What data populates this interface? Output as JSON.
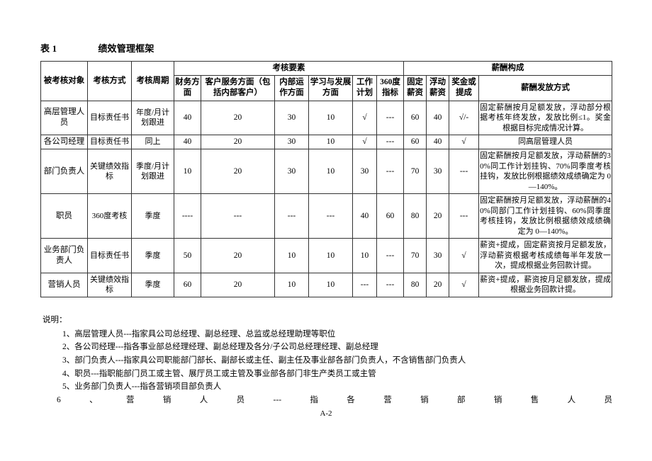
{
  "document": {
    "table_label": "表 1",
    "table_title": "绩效管理框架",
    "footer": "A-2"
  },
  "table": {
    "group_headers": {
      "assessment_elements": "考核要素",
      "salary_composition": "薪酬构成"
    },
    "columns": {
      "object": "被考核对象",
      "method": "考核方式",
      "cycle": "考核周期",
      "finance": "财务方面",
      "customer": "客户服务方面（包括内部客户）",
      "internal": "内部运作方面",
      "learning": "学习与发展方面",
      "work_plan": "工作计划",
      "deg360": "360度指标",
      "fixed_salary": "固定薪资",
      "float_salary": "浮动薪资",
      "bonus": "奖金或提成",
      "pay_method": "薪酬发放方式"
    },
    "rows": [
      {
        "object": "高层管理人员",
        "method": "目标责任书",
        "cycle": "年度/月计划跟进",
        "finance": "40",
        "customer": "20",
        "internal": "30",
        "learning": "10",
        "work_plan": "√",
        "deg360": "---",
        "fixed_salary": "60",
        "float_salary": "40",
        "bonus": "√/-",
        "pay_method": "固定薪酬按月足额发放，浮动部分根据考核年终发放，发放比例≤1。奖金根据目标完成情况计算。",
        "pay_method_justify": true
      },
      {
        "object": "各公司经理",
        "method": "目标责任书",
        "cycle": "同上",
        "finance": "40",
        "customer": "20",
        "internal": "30",
        "learning": "10",
        "work_plan": "√",
        "deg360": "---",
        "fixed_salary": "60",
        "float_salary": "40",
        "bonus": "√",
        "pay_method": "同高层管理人员",
        "pay_method_justify": false
      },
      {
        "object": "部门负责人",
        "method": "关键绩效指标",
        "cycle": "季度/月计划跟进",
        "finance": "10",
        "customer": "20",
        "internal": "30",
        "learning": "10",
        "work_plan": "30",
        "deg360": "---",
        "fixed_salary": "70",
        "float_salary": "30",
        "bonus": "---",
        "pay_method": "固定薪酬按月足额发放，浮动薪酬的30%同工作计划挂钩、70%同季度考核挂钩，发放比例根据绩效成绩确定为 0—140%。",
        "pay_method_justify": true
      },
      {
        "object": "职员",
        "method": "360度考核",
        "cycle": "季度",
        "finance": "----",
        "customer": "---",
        "internal": "---",
        "learning": "---",
        "work_plan": "40",
        "deg360": "60",
        "fixed_salary": "80",
        "float_salary": "20",
        "bonus": "---",
        "pay_method": "固定薪酬按月足额发放，浮动薪酬的40%同部门工作计划挂钩、60%同季度考核挂钩，发放比例根据绩效成绩确定为 0—140%。",
        "pay_method_justify": true
      },
      {
        "object": "业务部门负责人",
        "method": "目标责任书",
        "cycle": "季度",
        "finance": "50",
        "customer": "20",
        "internal": "10",
        "learning": "10",
        "work_plan": "10",
        "deg360": "---",
        "fixed_salary": "70",
        "float_salary": "30",
        "bonus": "√",
        "pay_method": "薪资+提成，固定薪资按月足额发放，浮动薪资根据考核成绩每半年发放一次，提成根据业务回款计提。",
        "pay_method_justify": true
      },
      {
        "object": "营销人员",
        "method": "关键绩效指标",
        "cycle": "季度",
        "finance": "60",
        "customer": "20",
        "internal": "10",
        "learning": "10",
        "work_plan": "---",
        "deg360": "---",
        "fixed_salary": "80",
        "float_salary": "20",
        "bonus": "√",
        "pay_method": "薪资+提成，薪资按月足额发放，提成根据业务回款计提。",
        "pay_method_justify": true
      }
    ]
  },
  "notes": {
    "title": "说明：",
    "items": [
      "1、高层管理人员---指家具公司总经理、副总经理、总监或总经理助理等职位",
      "2、各公司经理---指各事业部总经理经理、副总经理及各分/子公司总经理经理、副总经理",
      "3、部门负责人---指家具公司职能部门部长、副部长或主任、副主任及事业部各部门负责人，不含销售部门负责人",
      "4、职员---指职能部门员工或主管、展厅员工或主管及事业部各部门非生产类员工或主管",
      "5、业务部门负责人---指各营销项目部负责人",
      "6、营销人员---指各营销部销售人员"
    ]
  }
}
